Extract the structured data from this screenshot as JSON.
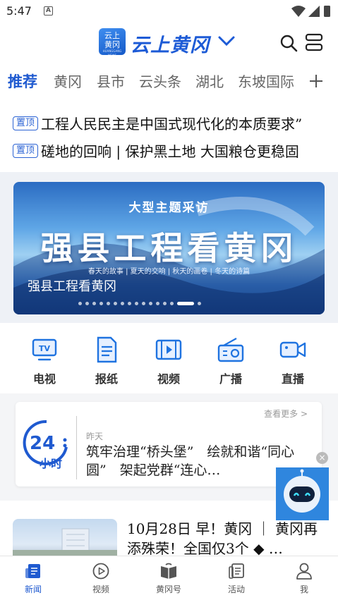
{
  "status_bar": {
    "time": "5:47",
    "notification_letter": "A"
  },
  "header": {
    "logo_line1": "云上",
    "logo_line2": "黄冈",
    "logo_line3": "HUANGGANG NEWS",
    "app_name": "云上黄冈"
  },
  "tabs": [
    {
      "label": "推荐",
      "active": true
    },
    {
      "label": "黄冈"
    },
    {
      "label": "县市"
    },
    {
      "label": "云头条"
    },
    {
      "label": "湖北"
    },
    {
      "label": "东坡国际"
    }
  ],
  "pinned": [
    {
      "badge": "置顶",
      "text": "工程人民民主是中国式现代化的本质要求”"
    },
    {
      "badge": "置顶",
      "text": "磋地的回响 | 保护黑土地 大国粮仓更稳固"
    }
  ],
  "banner": {
    "subtitle": "大型主题采访",
    "headline": "强县工程看黄冈",
    "strip": "春天的故事 | 夏天的交响 | 秋天的画卷 | 冬天的诗篇",
    "caption": "强县工程看黄冈",
    "dot_count": 16,
    "active_dot": 14
  },
  "quicknav": [
    {
      "label": "电视",
      "icon": "tv-icon"
    },
    {
      "label": "报纸",
      "icon": "newspaper-icon"
    },
    {
      "label": "视频",
      "icon": "video-icon"
    },
    {
      "label": "广播",
      "icon": "radio-icon"
    },
    {
      "label": "直播",
      "icon": "live-camera-icon"
    }
  ],
  "card24": {
    "logo_number": "24",
    "logo_unit": "小时",
    "more_label": "查看更多 >",
    "time": "昨天",
    "text": "筑牢治理“桥头堡”　绘就和谐“同心圆”　架起党群“连心…"
  },
  "robot": {
    "close_label": "×"
  },
  "news_item": {
    "title": "10月28日 早！黄冈 ｜ 黄冈再添殊荣！全国仅3个 ◆ …"
  },
  "bottom_nav": [
    {
      "label": "新闻",
      "icon": "news-icon",
      "active": true
    },
    {
      "label": "视频",
      "icon": "play-icon"
    },
    {
      "label": "黄冈号",
      "icon": "book-icon"
    },
    {
      "label": "活动",
      "icon": "activity-icon"
    },
    {
      "label": "我",
      "icon": "user-icon"
    }
  ],
  "colors": {
    "brand_blue": "#1f5ad0",
    "background": "#f4f5f7"
  }
}
